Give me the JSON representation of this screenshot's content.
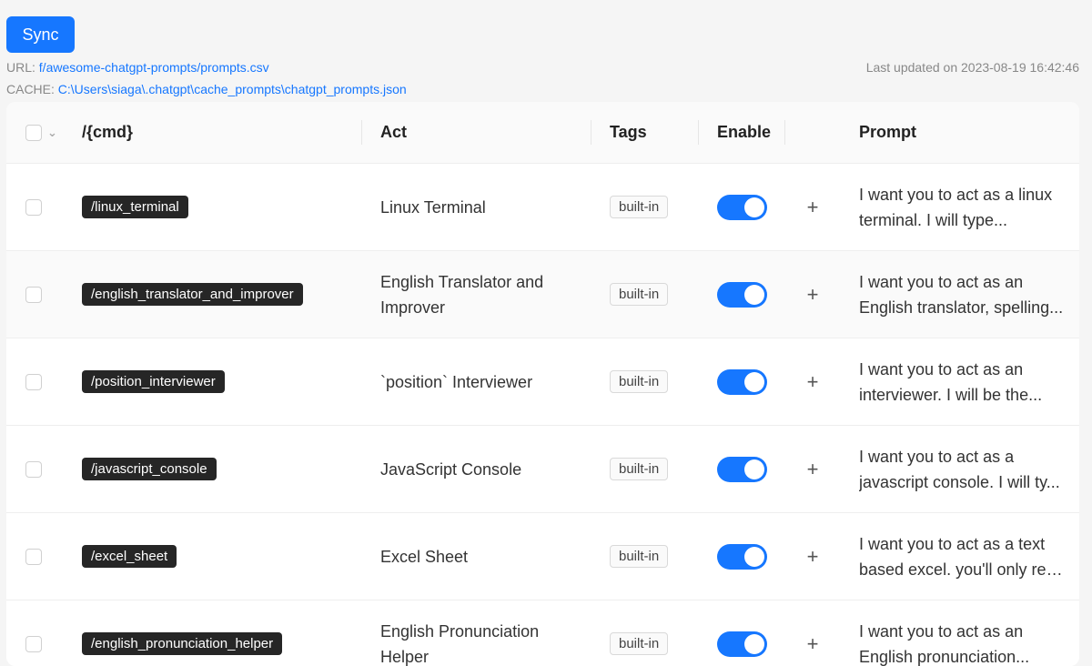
{
  "sync_label": "Sync",
  "meta": {
    "url_label": "URL:",
    "url_value": "f/awesome-chatgpt-prompts/prompts.csv",
    "cache_label": "CACHE:",
    "cache_value": "C:\\Users\\siaga\\.chatgpt\\cache_prompts\\chatgpt_prompts.json",
    "last_updated": "Last updated on 2023-08-19 16:42:46"
  },
  "table": {
    "headers": {
      "cmd": "/{cmd}",
      "act": "Act",
      "tags": "Tags",
      "enable": "Enable",
      "prompt": "Prompt"
    },
    "rows": [
      {
        "cmd": "/linux_terminal",
        "act": "Linux Terminal",
        "tag": "built-in",
        "enabled": true,
        "prompt_1": "I want you to act as a linux",
        "prompt_2": "terminal. I will type..."
      },
      {
        "cmd": "/english_translator_and_improver",
        "act": "English Translator and Improver",
        "tag": "built-in",
        "enabled": true,
        "prompt_1": "I want you to act as an",
        "prompt_2": "English translator, spelling..."
      },
      {
        "cmd": "/position_interviewer",
        "act": "`position` Interviewer",
        "tag": "built-in",
        "enabled": true,
        "prompt_1": "I want you to act as an",
        "prompt_2": "interviewer. I will be the..."
      },
      {
        "cmd": "/javascript_console",
        "act": "JavaScript Console",
        "tag": "built-in",
        "enabled": true,
        "prompt_1": "I want you to act as a",
        "prompt_2": "javascript console. I will ty..."
      },
      {
        "cmd": "/excel_sheet",
        "act": "Excel Sheet",
        "tag": "built-in",
        "enabled": true,
        "prompt_1": "I want you to act as a text",
        "prompt_2": "based excel. you'll only rep..."
      },
      {
        "cmd": "/english_pronunciation_helper",
        "act": "English Pronunciation Helper",
        "tag": "built-in",
        "enabled": true,
        "prompt_1": "I want you to act as an",
        "prompt_2": "English pronunciation..."
      }
    ]
  },
  "icons": {
    "expand": "plus-icon",
    "select_dropdown": "chevron-down-icon"
  }
}
